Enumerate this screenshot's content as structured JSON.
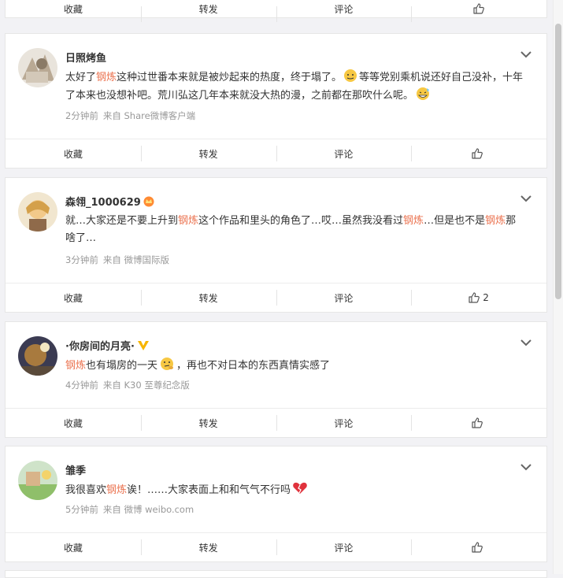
{
  "actions": {
    "favorite": "收藏",
    "repost": "转发",
    "comment": "评论"
  },
  "cards": [
    {
      "username": "日照烤鱼",
      "t1": "太好了",
      "kw1": "钢炼",
      "t2": "这种过世番本来就是被炒起来的热度，终于塌了。",
      "t3": "等等党别乘机说还好自己没补，十年了本来也没想补吧。荒川弘这几年本来就没大热的漫，之前都在那吹什么呢。",
      "time": "2分钟前",
      "source": "来自 Share微博客户端",
      "likes": ""
    },
    {
      "username": "森翎_1000629",
      "t1": "就…大家还是不要上升到",
      "kw1": "钢炼",
      "t2": "这个作品和里头的角色了…哎…虽然我没看过",
      "kw2": "钢炼",
      "t3": "…但是也不是",
      "kw3": "钢炼",
      "t4": "那啥了…",
      "time": "3分钟前",
      "source": "来自 微博国际版",
      "likes": "2"
    },
    {
      "username": "·你房间的月亮·",
      "kw1": "钢炼",
      "t1": "也有塌房的一天",
      "t2": "，再也不对日本的东西真情实感了",
      "time": "4分钟前",
      "source": "来自 K30 至尊纪念版",
      "likes": ""
    },
    {
      "username": "雏季",
      "t1": "我很喜欢",
      "kw1": "钢炼",
      "t2": "诶！……大家表面上和和气气不行吗",
      "time": "5分钟前",
      "source": "来自 微博 weibo.com",
      "likes": ""
    }
  ],
  "colors": {
    "keyword": "#eb7350",
    "meta": "#999999",
    "vip_badge": "#f7b500"
  }
}
